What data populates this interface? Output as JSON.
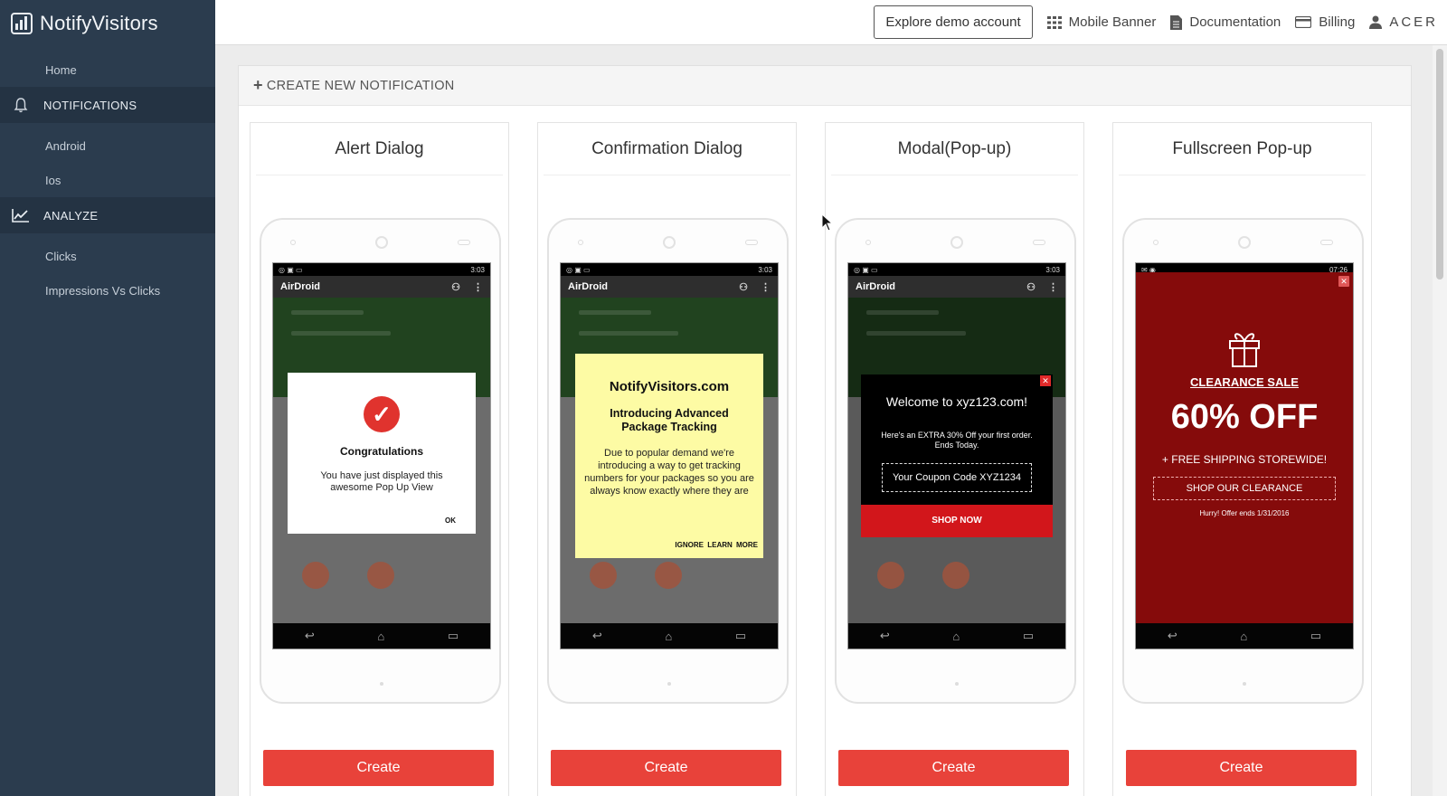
{
  "brand": {
    "name": "NotifyVisitors"
  },
  "sidebar": {
    "home": "Home",
    "notifications": "NOTIFICATIONS",
    "android": "Android",
    "ios": "Ios",
    "analyze": "ANALYZE",
    "clicks": "Clicks",
    "impressions": "Impressions Vs Clicks"
  },
  "topbar": {
    "demo": "Explore demo account",
    "mobile_banner": "Mobile Banner",
    "documentation": "Documentation",
    "billing": "Billing",
    "user": "ACER"
  },
  "panel": {
    "heading": "CREATE NEW NOTIFICATION"
  },
  "phone": {
    "app_name": "AirDroid",
    "time": "3:03",
    "time_fs": "07:26"
  },
  "cards": [
    {
      "title": "Alert Dialog",
      "popup": {
        "title": "Congratulations",
        "text": "You have just displayed this awesome Pop Up View",
        "ok": "OK"
      },
      "button": "Create"
    },
    {
      "title": "Confirmation Dialog",
      "popup": {
        "site": "NotifyVisitors.com",
        "title": "Introducing Advanced Package Tracking",
        "text": "Due to popular demand we're introducing a way to get tracking numbers for your packages so you are always know exactly where they are",
        "ignore": "IGNORE",
        "learn": "LEARN MORE"
      },
      "button": "Create"
    },
    {
      "title": "Modal(Pop-up)",
      "popup": {
        "welcome": "Welcome to xyz123.com!",
        "offer": "Here's an EXTRA 30% Off your first order. Ends Today.",
        "coupon": "Your Coupon Code XYZ1234",
        "shop": "SHOP NOW"
      },
      "button": "Create"
    },
    {
      "title": "Fullscreen Pop-up",
      "popup": {
        "sale": "CLEARANCE SALE",
        "off": "60% OFF",
        "shipping": "+ FREE SHIPPING STOREWIDE!",
        "shop": "SHOP OUR CLEARANCE",
        "hurry": "Hurry! Offer ends 1/31/2016"
      },
      "button": "Create"
    }
  ],
  "colors": {
    "sidebar": "#2b3c4e",
    "accent": "#e8423a",
    "fullscreen_bg": "#850b0b",
    "confirm_bg": "#fdfba4"
  },
  "icons": [
    "bar-chart-logo-icon",
    "bell-icon",
    "line-chart-icon",
    "grid-icon",
    "document-icon",
    "credit-card-icon",
    "user-icon",
    "plus-icon",
    "check-icon",
    "gift-icon",
    "close-icon"
  ]
}
